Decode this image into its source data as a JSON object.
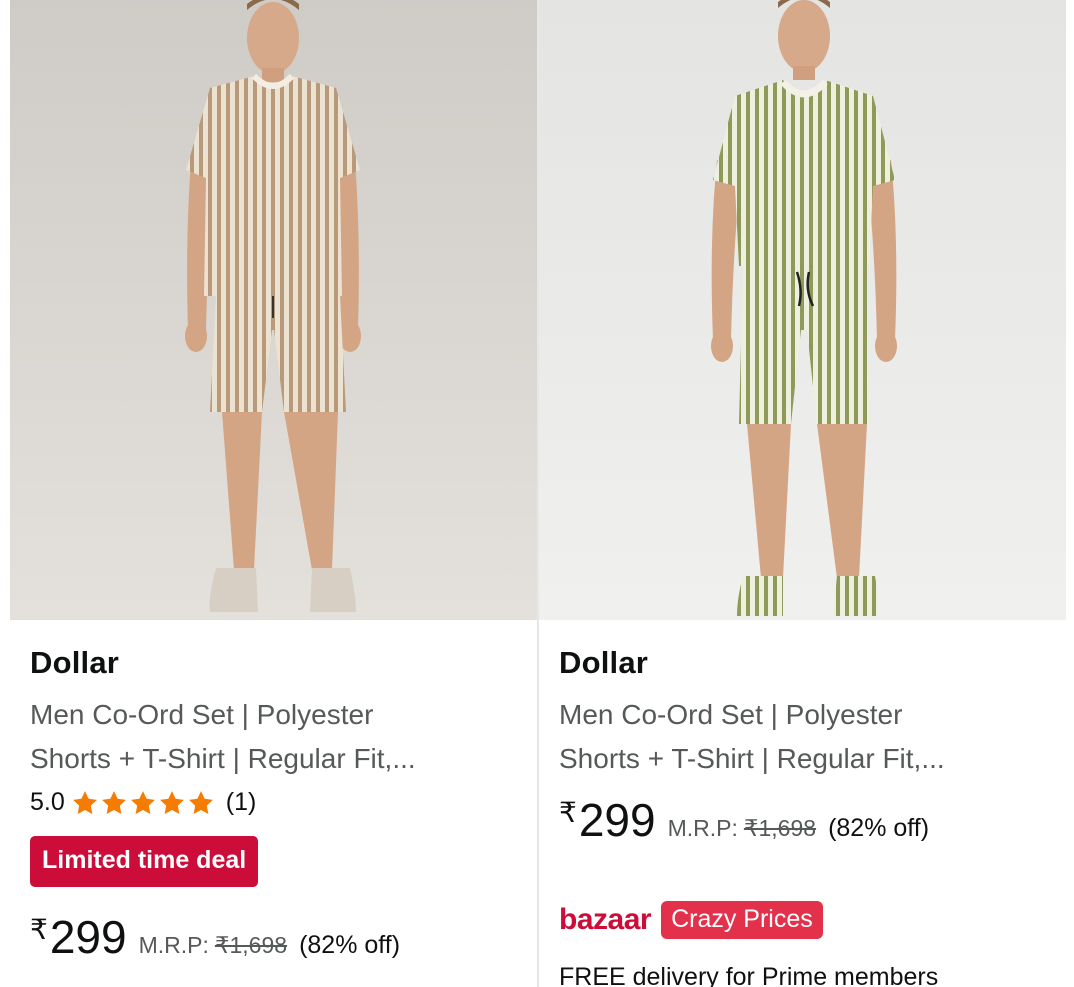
{
  "products": [
    {
      "brand": "Dollar",
      "title_line1": "Men Co-Ord Set | Polyester",
      "title_line2": "Shorts + T-Shirt | Regular Fit,...",
      "rating_value": "5.0",
      "rating_stars": 5,
      "rating_count": "(1)",
      "deal_badge": "Limited time deal",
      "currency": "₹",
      "price": "299",
      "mrp_label": "M.R.P:",
      "mrp_value": "₹1,698",
      "discount": "(82% off)",
      "image_icon": "product-photo-beige-striped-coord-set"
    },
    {
      "brand": "Dollar",
      "title_line1": "Men Co-Ord Set | Polyester",
      "title_line2": "Shorts + T-Shirt | Regular Fit,...",
      "currency": "₹",
      "price": "299",
      "mrp_label": "M.R.P:",
      "mrp_value": "₹1,698",
      "discount": "(82% off)",
      "bazaar_logo": "bazaar",
      "bazaar_badge": "Crazy Prices",
      "delivery": "FREE delivery for Prime members",
      "image_icon": "product-photo-green-striped-coord-set"
    }
  ],
  "colors": {
    "deal_red": "#cc0c39",
    "crazy_badge": "#e3304b",
    "star_orange": "#f57c00",
    "text_primary": "#0f1111",
    "text_secondary": "#565959",
    "stripe_beige": "#b89a7a",
    "stripe_green": "#8f9a5a"
  }
}
